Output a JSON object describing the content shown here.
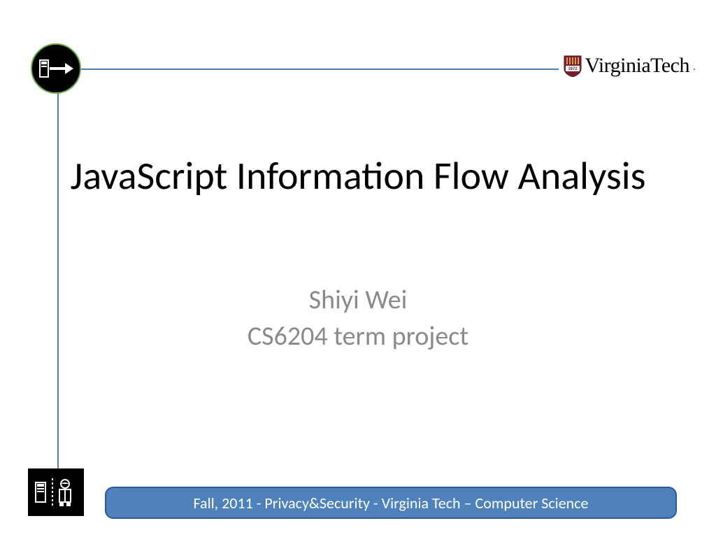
{
  "logo": {
    "text": "VirginiaTech",
    "shield_year": "1872"
  },
  "title": "JavaScript Information Flow Analysis",
  "author": "Shiyi Wei",
  "course": "CS6204 term project",
  "footer": "Fall, 2011  - Privacy&Security  - Virginia Tech – Computer Science",
  "icons": {
    "top": "file-arrow-right-icon",
    "bottom": "file-user-security-icon"
  }
}
